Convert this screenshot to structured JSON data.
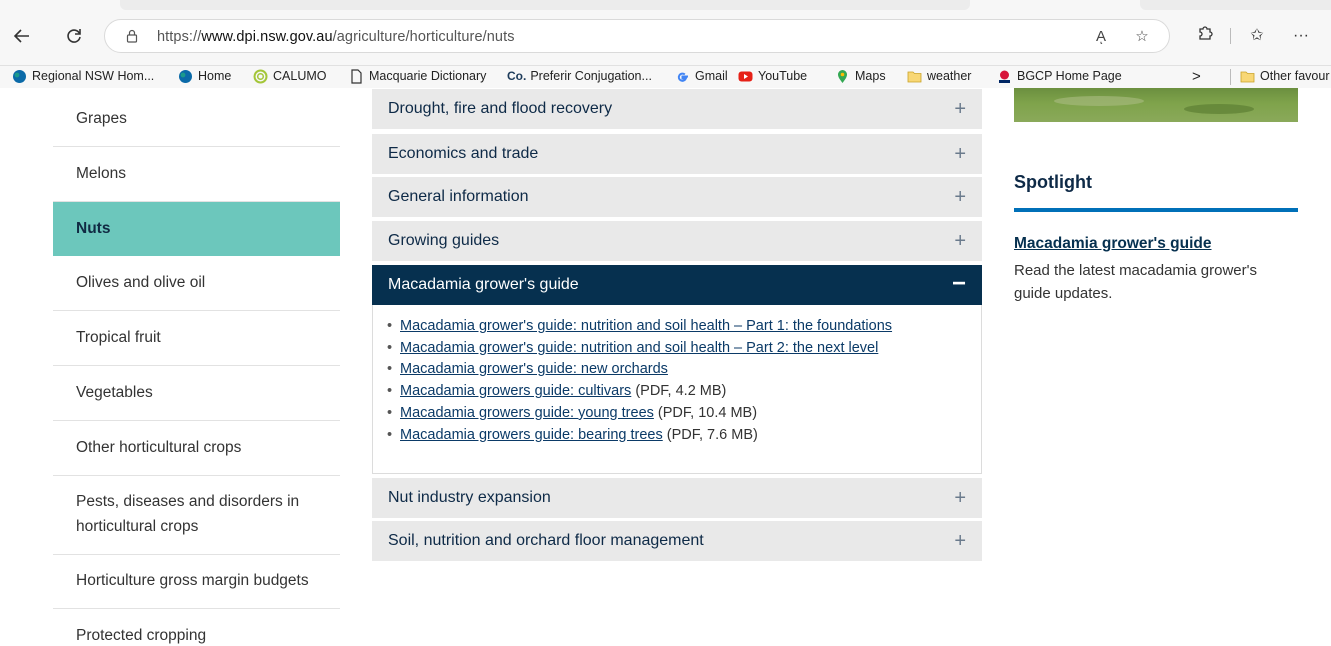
{
  "browser": {
    "url_prefix": "https://",
    "url_domain": "www.dpi.nsw.gov.au",
    "url_path": "/agriculture/horticulture/nuts",
    "read_aloud_icon": "Aͅ",
    "more_icon": "···"
  },
  "bookmarks": [
    {
      "label": "Regional NSW Hom...",
      "icon": "regional-nsw-icon"
    },
    {
      "label": "Home",
      "icon": "home-site-icon"
    },
    {
      "label": "CALUMO",
      "icon": "calumo-icon"
    },
    {
      "label": "Macquarie Dictionary",
      "icon": "page-icon"
    },
    {
      "label": "Preferir Conjugation...",
      "icon": "co-icon"
    },
    {
      "label": "Gmail",
      "icon": "google-icon"
    },
    {
      "label": "YouTube",
      "icon": "youtube-icon"
    },
    {
      "label": "Maps",
      "icon": "maps-icon"
    },
    {
      "label": "weather",
      "icon": "folder-icon"
    },
    {
      "label": "BGCP Home Page",
      "icon": "nsw-icon"
    },
    {
      "label": "Other favour",
      "icon": "folder-icon"
    }
  ],
  "bookmark_co_glyph": "Co.",
  "bookmark_overflow": ">",
  "sidenav": [
    {
      "label": "Grapes",
      "active": false
    },
    {
      "label": "Melons",
      "active": false
    },
    {
      "label": "Nuts",
      "active": true
    },
    {
      "label": "Olives and olive oil",
      "active": false
    },
    {
      "label": "Tropical fruit",
      "active": false
    },
    {
      "label": "Vegetables",
      "active": false
    },
    {
      "label": "Other horticultural crops",
      "active": false
    },
    {
      "label": "Pests, diseases and disorders in horticultural crops",
      "active": false
    },
    {
      "label": "Horticulture gross margin budgets",
      "active": false
    },
    {
      "label": "Protected cropping",
      "active": false
    }
  ],
  "accordion": {
    "sections": [
      {
        "title": "Drought, fire and flood recovery",
        "expanded": false
      },
      {
        "title": "Economics and trade",
        "expanded": false
      },
      {
        "title": "General information",
        "expanded": false
      },
      {
        "title": "Growing guides",
        "expanded": false
      },
      {
        "title": "Macadamia grower's guide",
        "expanded": true
      },
      {
        "title": "Nut industry expansion",
        "expanded": false
      },
      {
        "title": "Soil, nutrition and orchard floor management",
        "expanded": false
      }
    ],
    "plus_symbol": "+",
    "minus_symbol": "−",
    "bullet": "•",
    "links": [
      {
        "text": "Macadamia grower's guide: nutrition and soil health – Part 1: the foundations",
        "suffix": ""
      },
      {
        "text": "Macadamia grower's guide: nutrition and soil health – Part 2: the next level",
        "suffix": ""
      },
      {
        "text": "Macadamia grower's guide: new orchards",
        "suffix": ""
      },
      {
        "text": "Macadamia growers guide: cultivars",
        "suffix": " (PDF, 4.2 MB)"
      },
      {
        "text": "Macadamia growers guide: young trees",
        "suffix": " (PDF, 10.4 MB)"
      },
      {
        "text": "Macadamia growers guide: bearing trees",
        "suffix": " (PDF, 7.6 MB)"
      }
    ]
  },
  "spotlight": {
    "title": "Spotlight",
    "link": "Macadamia grower's guide",
    "text": "Read the latest macadamia grower's guide updates.",
    "rule_color": "#0070b8"
  },
  "colors": {
    "active_nav": "#6cc7bc",
    "accordion_open": "#06304f",
    "accordion_closed": "#e9e9e9"
  }
}
